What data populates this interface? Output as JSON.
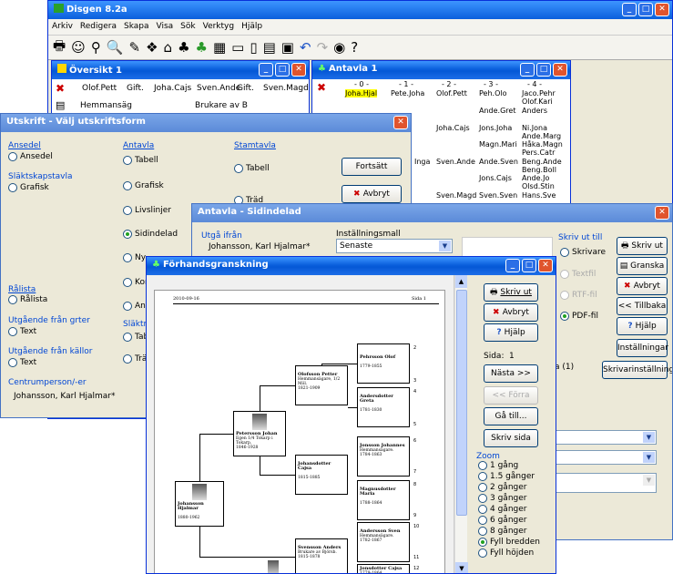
{
  "main": {
    "title": "Disgen 8.2a",
    "menu": [
      "Arkiv",
      "Redigera",
      "Skapa",
      "Visa",
      "Sök",
      "Verktyg",
      "Hjälp"
    ]
  },
  "oversikt": {
    "title": "Översikt 1",
    "c1": "Olof.Pett",
    "c2": "Gift.",
    "c3": "Joha.Cajs",
    "c4": "Sven.Ande",
    "c5": "Gift.",
    "c6": "Sven.Magd",
    "r2a": "Hemmansäg",
    "r2b": "Brukare av B"
  },
  "antavla": {
    "title": "Antavla 1",
    "hdr": [
      "- 0 -",
      "- 1 -",
      "- 2 -",
      "- 3 -",
      "- 4 -"
    ],
    "names": [
      "Joha.Hjal",
      "Pete.Joha",
      "Olof.Pett",
      "Peh.Olo",
      "Jaco.Pehr",
      "Olof.Kari",
      "Ande.Gret",
      "Anders",
      "Joha.Cajs",
      "Jons.Joha",
      "Ni.Jona",
      "Ande.Marg",
      "Magn.Mari",
      "Håka.Magn",
      "Pers.Catr",
      "Inga",
      "Sven.Ande",
      "Ande.Sven",
      "Beng.Ande",
      "Beng.Boll",
      "Jons.Cajs",
      "Ande.Jo",
      "Olsd.Stin",
      "Sven.Magd",
      "Sven.Sven",
      "Hans.Sve"
    ]
  },
  "utskrift": {
    "title": "Utskrift - Välj utskriftsform",
    "ansedel_h": "Ansedel",
    "ansedel_r": "Ansedel",
    "slakt_h": "Släktskapstavla",
    "slakt_r": "Grafisk",
    "antavla_h": "Antavla",
    "ant_r": [
      "Tabell",
      "Grafisk",
      "Livslinjer",
      "Sidindelad",
      "Ny",
      "Kon",
      "Ans"
    ],
    "stam_h": "Stamtavla",
    "stam_r": [
      "Tabell",
      "Träd"
    ],
    "ralista_h": "Rålista",
    "ralista_r": "Rålista",
    "utg_h": "Utgående från grter",
    "utg_r": "Text",
    "kall_h": "Utgående från källor",
    "kall_r": "Text",
    "slaktm_h": "Släktm",
    "slaktm_r": [
      "Tab",
      "Trä"
    ],
    "centrum_h": "Centrumperson/-er",
    "centrum_v": "Johansson, Karl Hjalmar*",
    "fortsatt": "Fortsätt",
    "avbryt": "Avbryt"
  },
  "sidindelad": {
    "title": "Antavla - Sidindelad",
    "utga_h": "Utgå ifrån",
    "utga_v": "Johansson, Karl Hjalmar*",
    "mall_h": "Inställningsmall",
    "mall_v": "Senaste",
    "skrivut_h": "Skriv ut till",
    "r": [
      "Skrivare",
      "Textfil",
      "RTF-fil",
      "PDF-fil"
    ],
    "btns": [
      "Skriv ut",
      "Granska",
      "Avbryt",
      "<< Tillbaka",
      "Hjälp",
      "Inställningar",
      "Skrivarinställningar"
    ],
    "count": "a (1)"
  },
  "preview": {
    "title": "Förhandsgranskning",
    "date": "2010-09-16",
    "page": "Sida 1",
    "btns": {
      "print": "Skriv ut",
      "cancel": "Avbryt",
      "help": "Hjälp",
      "next": "Nästa >>",
      "prev": "<< Förra",
      "goto": "Gå till...",
      "printpage": "Skriv sida"
    },
    "sida_label": "Sida:",
    "sida_val": "1",
    "zoom_h": "Zoom",
    "zoom": [
      "1 gång",
      "1.5 gånger",
      "2 gånger",
      "3 gånger",
      "4 gånger",
      "6 gånger",
      "8 gånger",
      "Fyll bredden",
      "Fyll höjden"
    ],
    "persons": [
      {
        "n": "Johansson Hjalmar",
        "d": "1880-1962"
      },
      {
        "n": "Petersson Johan",
        "s": "Egen 1/4 Tokarp i Tokarp,",
        "d": "1846-1928"
      },
      {
        "n": "Olofsson Petter",
        "s": "Hemmansägare, 1/2 Möl.",
        "d": "1821-1909"
      },
      {
        "n": "Pehrsson Olof",
        "d": "1779-1855"
      },
      {
        "n": "Andersdotter Greta",
        "d": "1781-1830"
      },
      {
        "n": "Johansdotter Cajsa",
        "d": "1815-1885"
      },
      {
        "n": "Jonsson Johannes",
        "s": "Hemmansägare.",
        "d": "1784-1863"
      },
      {
        "n": "Magnusdotter Maria",
        "d": "1788-1864"
      },
      {
        "n": "Svensson Anders",
        "s": "Brukare av Björsb.",
        "d": "1815-1878"
      },
      {
        "n": "Andersson Sven",
        "s": "Hemmansägare.",
        "d": "1782-1867"
      },
      {
        "n": "Jonsdotter Cajsa",
        "d": "1779-1864"
      }
    ],
    "nums": [
      "2",
      "3",
      "4",
      "5",
      "6",
      "7",
      "8",
      "9",
      "10",
      "11",
      "12"
    ]
  }
}
